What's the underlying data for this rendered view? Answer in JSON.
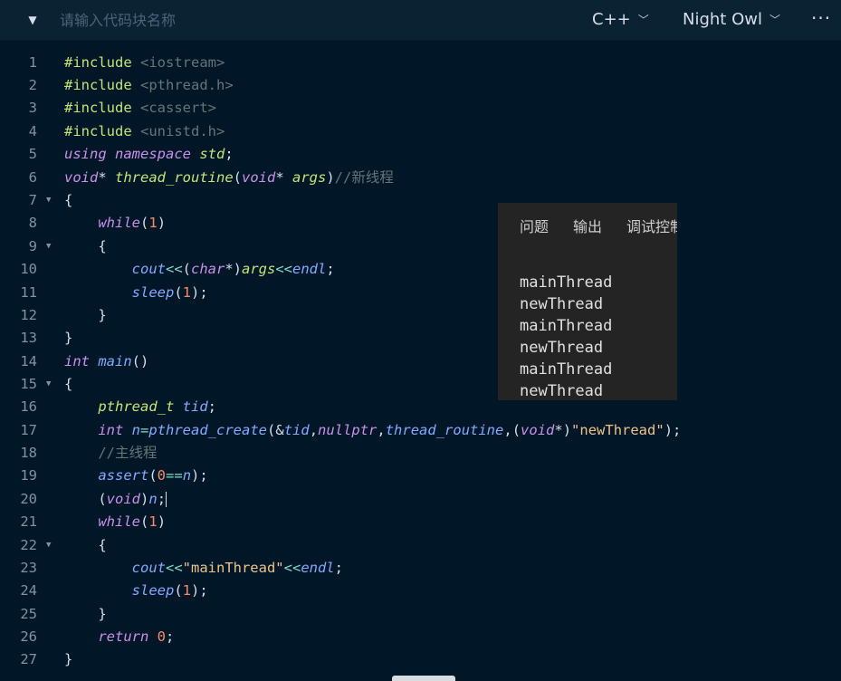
{
  "toolbar": {
    "name_placeholder": "请输入代码块名称",
    "language": "C++",
    "theme": "Night Owl",
    "more": "···"
  },
  "code_lines": [
    {
      "num": "1",
      "fold": false
    },
    {
      "num": "2",
      "fold": false
    },
    {
      "num": "3",
      "fold": false
    },
    {
      "num": "4",
      "fold": false
    },
    {
      "num": "5",
      "fold": false
    },
    {
      "num": "6",
      "fold": false
    },
    {
      "num": "7",
      "fold": true
    },
    {
      "num": "8",
      "fold": false
    },
    {
      "num": "9",
      "fold": true
    },
    {
      "num": "10",
      "fold": false
    },
    {
      "num": "11",
      "fold": false
    },
    {
      "num": "12",
      "fold": false
    },
    {
      "num": "13",
      "fold": false
    },
    {
      "num": "14",
      "fold": false
    },
    {
      "num": "15",
      "fold": true
    },
    {
      "num": "16",
      "fold": false
    },
    {
      "num": "17",
      "fold": false
    },
    {
      "num": "18",
      "fold": false
    },
    {
      "num": "19",
      "fold": false
    },
    {
      "num": "20",
      "fold": false
    },
    {
      "num": "21",
      "fold": false
    },
    {
      "num": "22",
      "fold": true
    },
    {
      "num": "23",
      "fold": false
    },
    {
      "num": "24",
      "fold": false
    },
    {
      "num": "25",
      "fold": false
    },
    {
      "num": "26",
      "fold": false
    },
    {
      "num": "27",
      "fold": false
    }
  ],
  "code": {
    "l1_kw": "#include",
    "l1_hdr": "<iostream>",
    "l2_kw": "#include",
    "l2_hdr": "<pthread.h>",
    "l3_kw": "#include",
    "l3_hdr": "<cassert>",
    "l4_kw": "#include",
    "l4_hdr": "<unistd.h>",
    "l5_a": "using",
    "l5_b": "namespace",
    "l5_c": "std",
    "l5_d": ";",
    "l6_a": "void",
    "l6_b": "* ",
    "l6_c": "thread_routine",
    "l6_d": "(",
    "l6_e": "void",
    "l6_f": "* ",
    "l6_g": "args",
    "l6_h": ")",
    "l6_i": "//新线程",
    "l7": "{",
    "l8_a": "while",
    "l8_b": "(",
    "l8_c": "1",
    "l8_d": ")",
    "l9": "{",
    "l10_a": "cout",
    "l10_b": "<<",
    "l10_c": "(",
    "l10_d": "char",
    "l10_e": "*)",
    "l10_f": "args",
    "l10_g": "<<",
    "l10_h": "endl",
    "l10_i": ";",
    "l11_a": "sleep",
    "l11_b": "(",
    "l11_c": "1",
    "l11_d": ");",
    "l12": "}",
    "l13": "}",
    "l14_a": "int",
    "l14_b": "main",
    "l14_c": "()",
    "l15": "{",
    "l16_a": "pthread_t",
    "l16_b": "tid",
    "l16_c": ";",
    "l17_a": "int",
    "l17_b": "n",
    "l17_c": "=",
    "l17_d": "pthread_create",
    "l17_e": "(&",
    "l17_f": "tid",
    "l17_g": ",",
    "l17_h": "nullptr",
    "l17_i": ",",
    "l17_j": "thread_routine",
    "l17_k": ",(",
    "l17_l": "void",
    "l17_m": "*)",
    "l17_n": "\"newThread\"",
    "l17_o": ");",
    "l18": "//主线程",
    "l19_a": "assert",
    "l19_b": "(",
    "l19_c": "0",
    "l19_d": "==",
    "l19_e": "n",
    "l19_f": ");",
    "l20_a": "(",
    "l20_b": "void",
    "l20_c": ")",
    "l20_d": "n",
    "l20_e": ";",
    "l21_a": "while",
    "l21_b": "(",
    "l21_c": "1",
    "l21_d": ")",
    "l22": "{",
    "l23_a": "cout",
    "l23_b": "<<",
    "l23_c": "\"mainThread\"",
    "l23_d": "<<",
    "l23_e": "endl",
    "l23_f": ";",
    "l24_a": "sleep",
    "l24_b": "(",
    "l24_c": "1",
    "l24_d": ");",
    "l25": "}",
    "l26_a": "return",
    "l26_b": "0",
    "l26_c": ";",
    "l27": "}"
  },
  "panel": {
    "tabs": [
      "问题",
      "输出",
      "调试控制台"
    ],
    "output": [
      "mainThread",
      "newThread",
      "mainThread",
      "newThread",
      "mainThread",
      "newThread"
    ]
  }
}
